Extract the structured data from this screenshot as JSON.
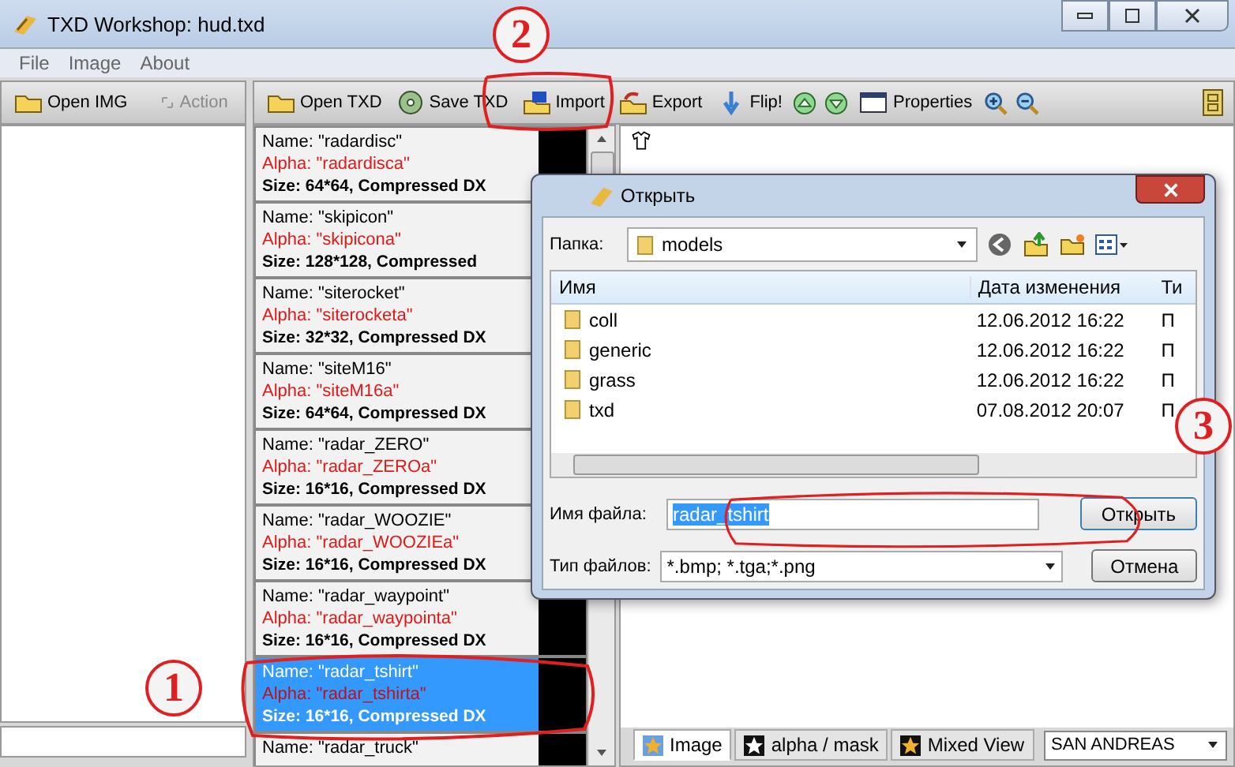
{
  "window": {
    "title": "TXD Workshop: hud.txd"
  },
  "menu": [
    "File",
    "Image",
    "About"
  ],
  "side_toolbar": [
    {
      "label": "Open IMG",
      "disabled": false
    },
    {
      "label": "Action",
      "disabled": true
    }
  ],
  "toolbar": [
    {
      "kind": "button",
      "label": "Open TXD"
    },
    {
      "kind": "button",
      "label": "Save TXD"
    },
    {
      "kind": "button",
      "label": "Import"
    },
    {
      "kind": "button",
      "label": "Export"
    },
    {
      "kind": "button",
      "label": "Flip!"
    },
    {
      "kind": "icon"
    },
    {
      "kind": "icon"
    },
    {
      "kind": "button",
      "label": "Properties"
    },
    {
      "kind": "icon"
    },
    {
      "kind": "icon"
    }
  ],
  "textures": [
    {
      "name": "Name: \"radardisc\"",
      "alpha": "Alpha: \"radardisca\"",
      "size": "Size: 64*64, Compressed DX",
      "selected": false
    },
    {
      "name": "Name: \"skipicon\"",
      "alpha": "Alpha: \"skipicona\"",
      "size": "Size: 128*128, Compressed",
      "selected": false
    },
    {
      "name": "Name: \"siterocket\"",
      "alpha": "Alpha: \"siterocketa\"",
      "size": "Size: 32*32, Compressed DX",
      "selected": false
    },
    {
      "name": "Name: \"siteM16\"",
      "alpha": "Alpha: \"siteM16a\"",
      "size": "Size: 64*64, Compressed DX",
      "selected": false
    },
    {
      "name": "Name: \"radar_ZERO\"",
      "alpha": "Alpha: \"radar_ZEROa\"",
      "size": "Size: 16*16, Compressed DX",
      "selected": false
    },
    {
      "name": "Name: \"radar_WOOZIE\"",
      "alpha": "Alpha: \"radar_WOOZIEa\"",
      "size": "Size: 16*16, Compressed DX",
      "selected": false
    },
    {
      "name": "Name: \"radar_waypoint\"",
      "alpha": "Alpha: \"radar_waypointa\"",
      "size": "Size: 16*16, Compressed DX",
      "selected": false
    },
    {
      "name": "Name: \"radar_tshirt\"",
      "alpha": "Alpha: \"radar_tshirta\"",
      "size": "Size: 16*16, Compressed DX",
      "selected": true
    },
    {
      "name": "Name: \"radar_truck\"",
      "selected": false
    }
  ],
  "view_tabs": [
    {
      "label": "Image",
      "selected": true
    },
    {
      "label": "alpha / mask",
      "selected": false
    },
    {
      "label": "Mixed View",
      "selected": false
    }
  ],
  "game_select": {
    "value": "SAN ANDREAS"
  },
  "dialog": {
    "title": "Открыть",
    "folder_label": "Папка:",
    "folder": "models",
    "columns": [
      "Имя",
      "Дата изменения",
      "Ти"
    ],
    "rows": [
      {
        "name": "coll",
        "date": "12.06.2012 16:22",
        "type": "П"
      },
      {
        "name": "generic",
        "date": "12.06.2012 16:22",
        "type": "П"
      },
      {
        "name": "grass",
        "date": "12.06.2012 16:22",
        "type": "П"
      },
      {
        "name": "txd",
        "date": "07.08.2012 20:07",
        "type": "П"
      }
    ],
    "filename_label": "Имя файла:",
    "filename": "radar_tshirt",
    "open_button": "Открыть",
    "filetype_label": "Тип файлов:",
    "filetype": "*.bmp; *.tga;*.png",
    "cancel_button": "Отмена"
  },
  "annotations": [
    "1",
    "2",
    "3"
  ]
}
